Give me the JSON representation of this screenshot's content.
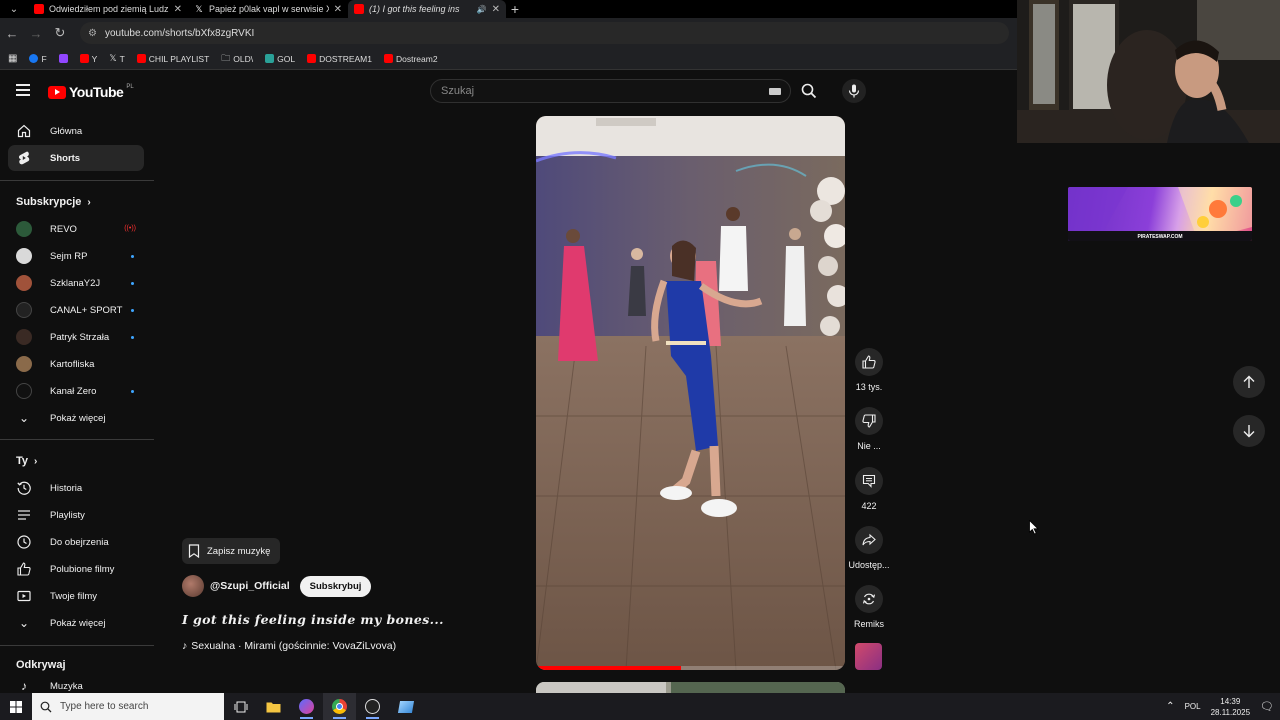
{
  "browser": {
    "tabs": [
      {
        "title": "Odwiedziłem pod ziemią Ludzi",
        "icon": "youtube-icon",
        "active": false
      },
      {
        "title": "Papież p0lak vapl w serwisie X",
        "icon": "x-icon",
        "active": false
      },
      {
        "title": "(1) I got this feeling ins",
        "icon": "youtube-icon",
        "active": true
      }
    ],
    "url": "youtube.com/shorts/bXfx8zgRVKI",
    "bookmarks": [
      {
        "label": "F",
        "icon": "facebook-icon"
      },
      {
        "label": "",
        "icon": "twitch-icon"
      },
      {
        "label": "Y",
        "icon": "youtube-icon"
      },
      {
        "label": "T",
        "icon": "x-icon"
      },
      {
        "label": "CHIL PLAYLIST",
        "icon": "youtube-icon"
      },
      {
        "label": "OLD\\",
        "icon": "folder-icon"
      },
      {
        "label": "GOL",
        "icon": "gol-icon"
      },
      {
        "label": "DOSTREAM1",
        "icon": "youtube-icon"
      },
      {
        "label": "Dostream2",
        "icon": "youtube-icon"
      }
    ]
  },
  "header": {
    "logo_text": "YouTube",
    "country_code": "PL",
    "search_placeholder": "Szukaj"
  },
  "sidebar": {
    "main": [
      {
        "label": "Główna",
        "icon": "home-icon",
        "active": false
      },
      {
        "label": "Shorts",
        "icon": "shorts-icon",
        "active": true
      }
    ],
    "subs_title": "Subskrypcje",
    "subscriptions": [
      {
        "label": "REVO",
        "color": "#2c5a3a",
        "live": true
      },
      {
        "label": "Sejm RP",
        "color": "#d9d9d9",
        "live": false
      },
      {
        "label": "SzklanaY2J",
        "color": "#a0523a",
        "live": false
      },
      {
        "label": "CANAL+ SPORT",
        "color": "#222222",
        "live": false
      },
      {
        "label": "Patryk Strzała",
        "color": "#3a2a24",
        "live": false
      },
      {
        "label": "Kartofliska",
        "color": "#8a6a4a",
        "live": false
      },
      {
        "label": "Kanał Zero",
        "color": "#111111",
        "live": false
      }
    ],
    "show_more": "Pokaż więcej",
    "you_title": "Ty",
    "you": [
      {
        "label": "Historia",
        "icon": "history-icon"
      },
      {
        "label": "Playlisty",
        "icon": "playlist-icon"
      },
      {
        "label": "Do obejrzenia",
        "icon": "clock-icon"
      },
      {
        "label": "Polubione filmy",
        "icon": "thumb-up-icon"
      },
      {
        "label": "Twoje filmy",
        "icon": "video-icon"
      }
    ],
    "show_more2": "Pokaż więcej",
    "explore_title": "Odkrywaj",
    "explore_first": "Muzyka"
  },
  "short": {
    "save_music": "Zapisz muzykę",
    "channel": "@Szupi_Official",
    "subscribe": "Subskrybuj",
    "title": "I got this feeling inside my bones...",
    "sound": "Sexualna · Mirami (gościnnie: VovaZiLvova)",
    "progress": 0.47,
    "actions": {
      "likes": "13 tys.",
      "dislike": "Nie ...",
      "comments": "422",
      "share": "Udostęp...",
      "remix": "Remiks"
    }
  },
  "ad": {
    "text": "PIRATESWAP.COM"
  },
  "taskbar": {
    "search_placeholder": "Type here to search",
    "language": "POL",
    "time": "14:39",
    "date": "28.11.2025"
  }
}
